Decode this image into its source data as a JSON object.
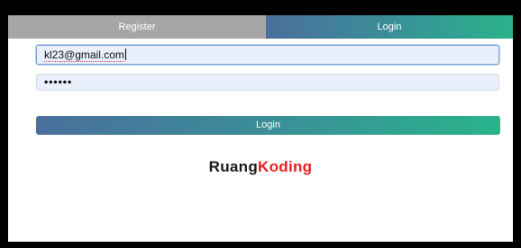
{
  "tabs": {
    "register_label": "Register",
    "login_label": "Login",
    "active": "Login"
  },
  "form": {
    "email_value": "kl23@gmail.com",
    "password_mask": "••••••"
  },
  "actions": {
    "login_label": "Login"
  },
  "brand": {
    "part1": "Ruang",
    "part2": "Koding",
    "part1_color": "#1a1a1a",
    "part2_color": "#e8201e"
  },
  "colors": {
    "gradient_start": "#4a6f9c",
    "gradient_end": "#2ab38b",
    "inactive_tab": "#a6a6a6",
    "input_bg": "#e9f0fb"
  }
}
